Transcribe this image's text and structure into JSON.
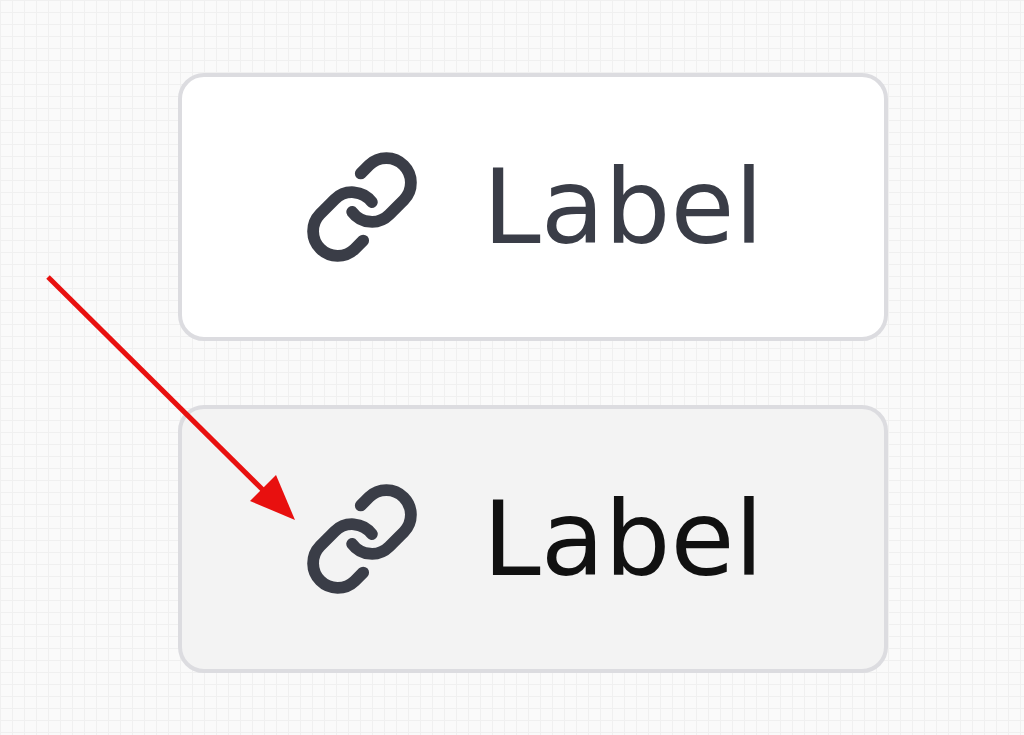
{
  "buttons": [
    {
      "label": "Label",
      "hovered": false,
      "pointed": false
    },
    {
      "label": "Label",
      "hovered": true,
      "pointed": true
    }
  ]
}
